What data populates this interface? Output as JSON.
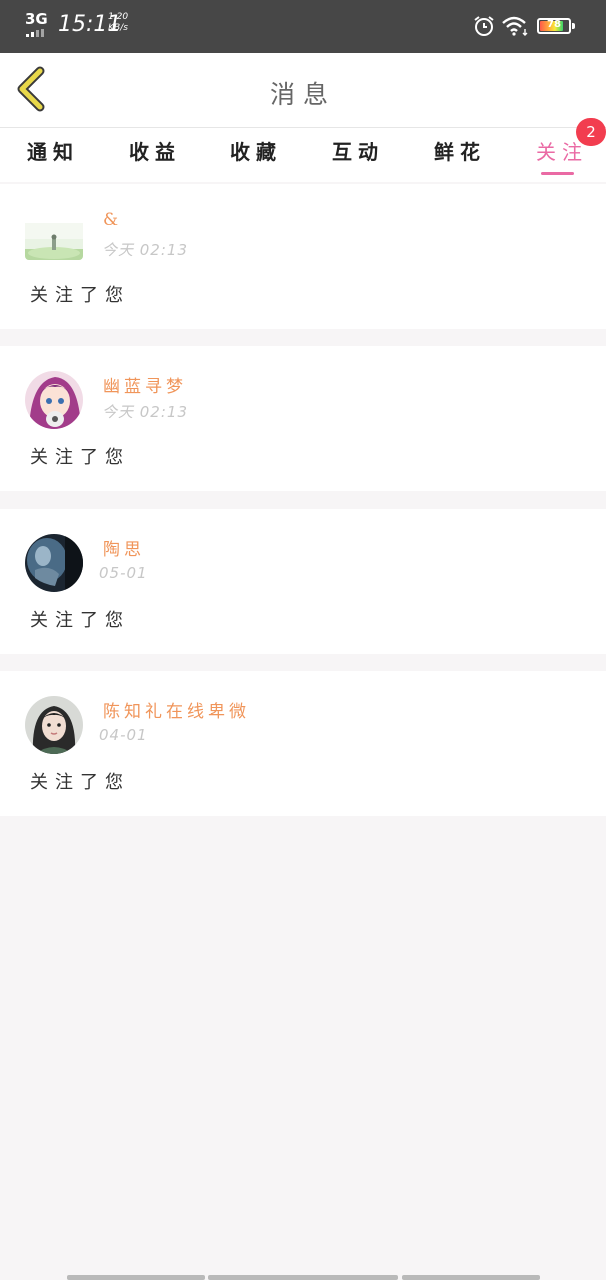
{
  "status_bar": {
    "network": "3G",
    "time": "15:11",
    "speed_value": "1.20",
    "speed_unit": "KB/s",
    "battery_level": "78",
    "icons": [
      "signal-icon",
      "alarm-icon",
      "wifi-icon",
      "battery-icon"
    ]
  },
  "header": {
    "title": "消息",
    "back_icon": "chevron-left-icon",
    "back_color": "#e8d84a"
  },
  "tabs": {
    "items": [
      {
        "label": "通知"
      },
      {
        "label": "收益"
      },
      {
        "label": "收藏"
      },
      {
        "label": "互动"
      },
      {
        "label": "鲜花"
      },
      {
        "label": "关注"
      }
    ],
    "active_index": 5,
    "badge": "2",
    "accent_color": "#ea6aa4"
  },
  "notifications": [
    {
      "name": "&",
      "time": "今天 02:13",
      "message": "关注了您"
    },
    {
      "name": "幽蓝寻梦",
      "time": "今天 02:13",
      "message": "关注了您"
    },
    {
      "name": "陶思",
      "time": "05-01",
      "message": "关注了您"
    },
    {
      "name": "陈知礼在线卑微",
      "time": "04-01",
      "message": "关注了您"
    }
  ],
  "colors": {
    "name": "#f0955a",
    "time": "#c7c7c7",
    "badge": "#f23d4f",
    "background": "#f7f5f6"
  }
}
